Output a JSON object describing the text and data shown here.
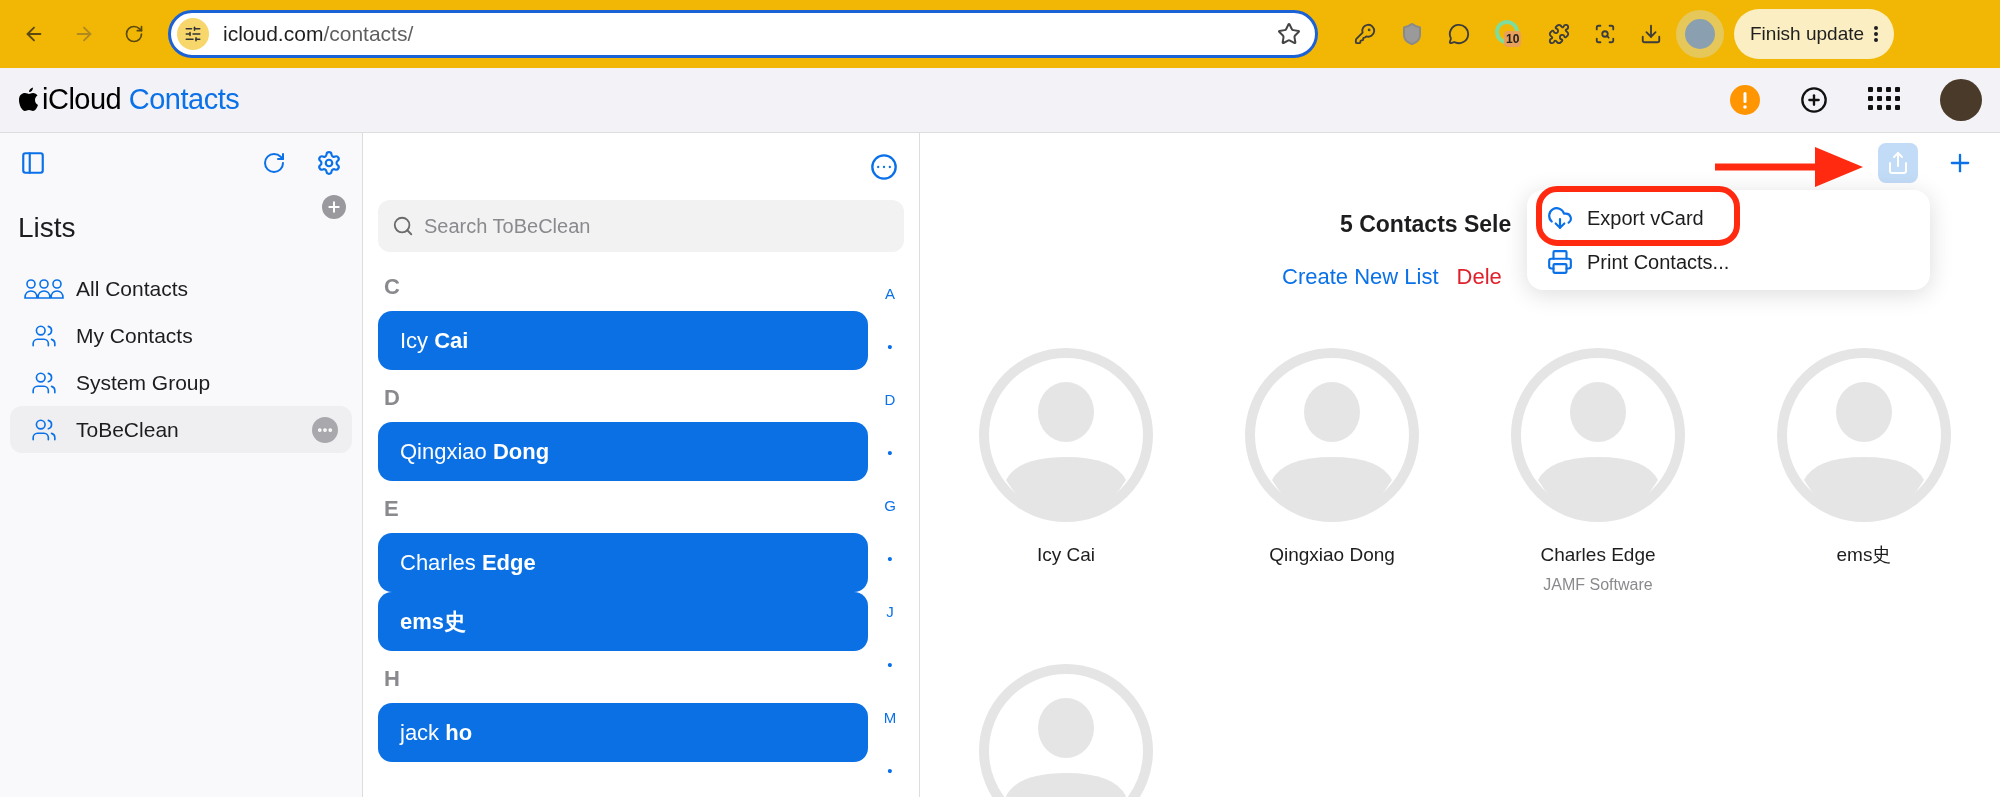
{
  "browser": {
    "url_host": "icloud.com",
    "url_path": "/contacts/",
    "extension_badge": "10",
    "update_button": "Finish update"
  },
  "header": {
    "brand": "iCloud",
    "app": "Contacts"
  },
  "sidebar": {
    "title": "Lists",
    "items": [
      {
        "label": "All Contacts",
        "kind": "all",
        "selected": false
      },
      {
        "label": "My Contacts",
        "kind": "group",
        "selected": false
      },
      {
        "label": "System Group",
        "kind": "group",
        "selected": false
      },
      {
        "label": "ToBeClean",
        "kind": "group",
        "selected": true
      }
    ]
  },
  "contact_list": {
    "search_placeholder": "Search ToBeClean",
    "sections": [
      {
        "letter": "C",
        "contacts": [
          {
            "name": "Icy **Cai**",
            "selected": true
          }
        ]
      },
      {
        "letter": "D",
        "contacts": [
          {
            "name": "Qingxiao **Dong**",
            "selected": true
          }
        ]
      },
      {
        "letter": "E",
        "contacts": [
          {
            "name": "Charles **Edge**",
            "selected": true
          },
          {
            "name": "**ems史**",
            "selected": true
          }
        ]
      },
      {
        "letter": "H",
        "contacts": [
          {
            "name": "jack **ho**",
            "selected": true
          }
        ]
      }
    ],
    "index": [
      "A",
      "•",
      "D",
      "•",
      "G",
      "•",
      "J",
      "•",
      "M",
      "•"
    ]
  },
  "detail": {
    "title": "5 Contacts Sele",
    "actions": [
      {
        "label": "Create New List",
        "kind": "primary"
      },
      {
        "label": "Dele",
        "kind": "destructive"
      }
    ],
    "cards": [
      {
        "kind": "labeled",
        "name": "Icy Cai"
      },
      {
        "kind": "labeled",
        "name": "Qingxiao Dong"
      },
      {
        "kind": "labeled",
        "name": "Charles Edge",
        "subtitle": "JAMF Software"
      },
      {
        "kind": "labeled",
        "name": "ems史"
      },
      {
        "kind": "avatar_only"
      }
    ],
    "menu": {
      "items": [
        {
          "label": "Export vCard",
          "kind": "export"
        },
        {
          "label": "Print Contacts...",
          "kind": "print"
        }
      ]
    }
  }
}
